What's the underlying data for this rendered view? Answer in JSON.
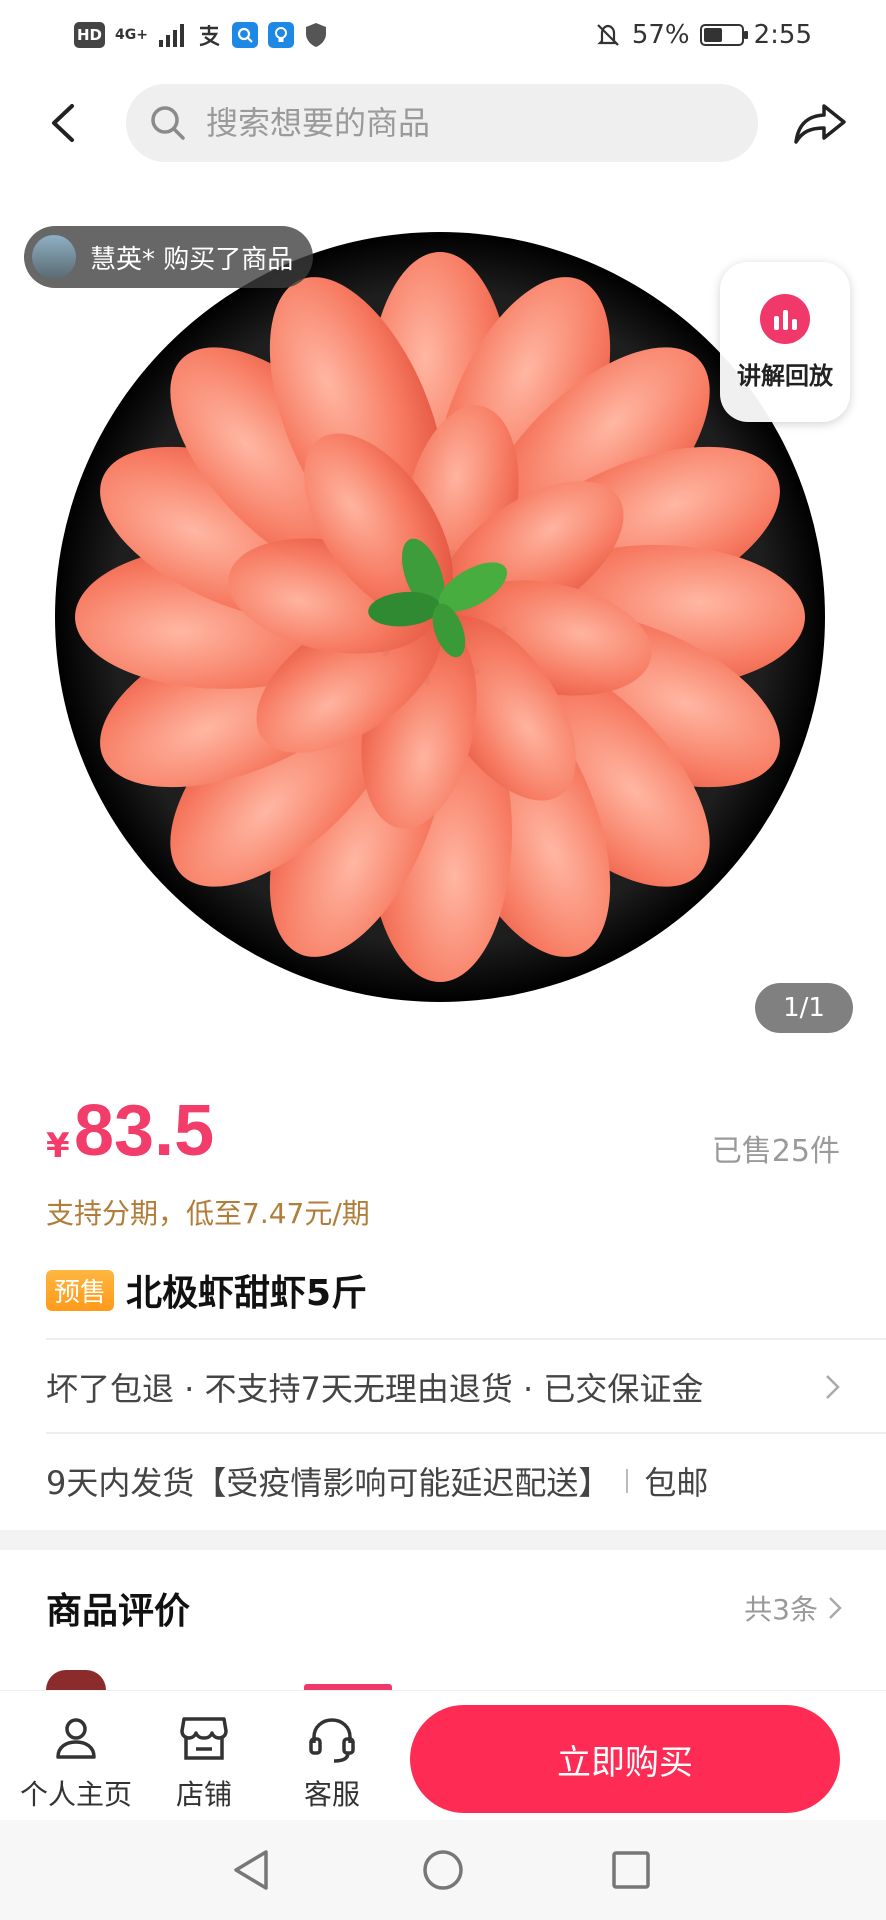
{
  "status_bar": {
    "hd_label": "HD",
    "network_label": "4G+",
    "battery_level_percent": 57,
    "battery_text": "57%",
    "time": "2:55"
  },
  "nav": {
    "search_placeholder": "搜索想要的商品"
  },
  "gallery": {
    "buyer_notice": "慧英* 购买了商品",
    "replay_label": "讲解回放",
    "page_indicator": "1/1"
  },
  "product": {
    "currency_symbol": "¥",
    "price": "83.5",
    "sold_text": "已售25件",
    "installment_text": "支持分期，低至7.47元/期",
    "presale_badge": "预售",
    "title": "北极虾甜虾5斤",
    "guarantee_text": "坏了包退 · 不支持7天无理由退货 · 已交保证金",
    "shipping_text": "9天内发货【受疫情影响可能延迟配送】",
    "shipping_tag": "包邮"
  },
  "reviews": {
    "title": "商品评价",
    "count_text": "共3条"
  },
  "bottom_bar": {
    "profile_label": "个人主页",
    "shop_label": "店铺",
    "service_label": "客服",
    "buy_label": "立即购买"
  },
  "colors": {
    "accent": "#fe2c55",
    "price": "#f23c6a",
    "installment": "#b07d3a",
    "presale": "#ff9a1a"
  }
}
